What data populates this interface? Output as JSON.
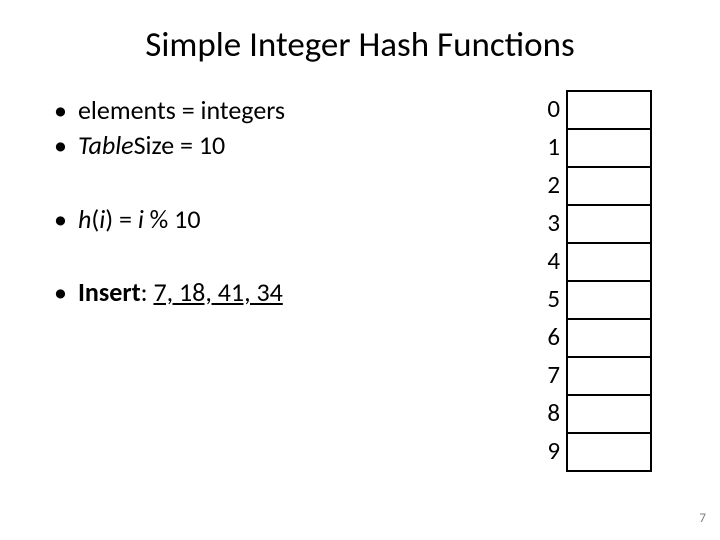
{
  "title": "Simple Integer Hash Functions",
  "bullets": {
    "b1_pre": "elements = integers",
    "b2_pre": "Table",
    "b2_emph": "Size",
    "b2_post": " = 10",
    "b3_h": "h",
    "b3_open": "(",
    "b3_i1": "i",
    "b3_close": ") = ",
    "b3_i2": "i",
    "b3_post": " % 10",
    "b4_label": "Insert",
    "b4_colon": ": ",
    "b4_vals": "7, 18, 41, 34"
  },
  "table": {
    "indices": [
      "0",
      "1",
      "2",
      "3",
      "4",
      "5",
      "6",
      "7",
      "8",
      "9"
    ],
    "cells": [
      "",
      "",
      "",
      "",
      "",
      "",
      "",
      "",
      "",
      ""
    ]
  },
  "page_number": "7"
}
